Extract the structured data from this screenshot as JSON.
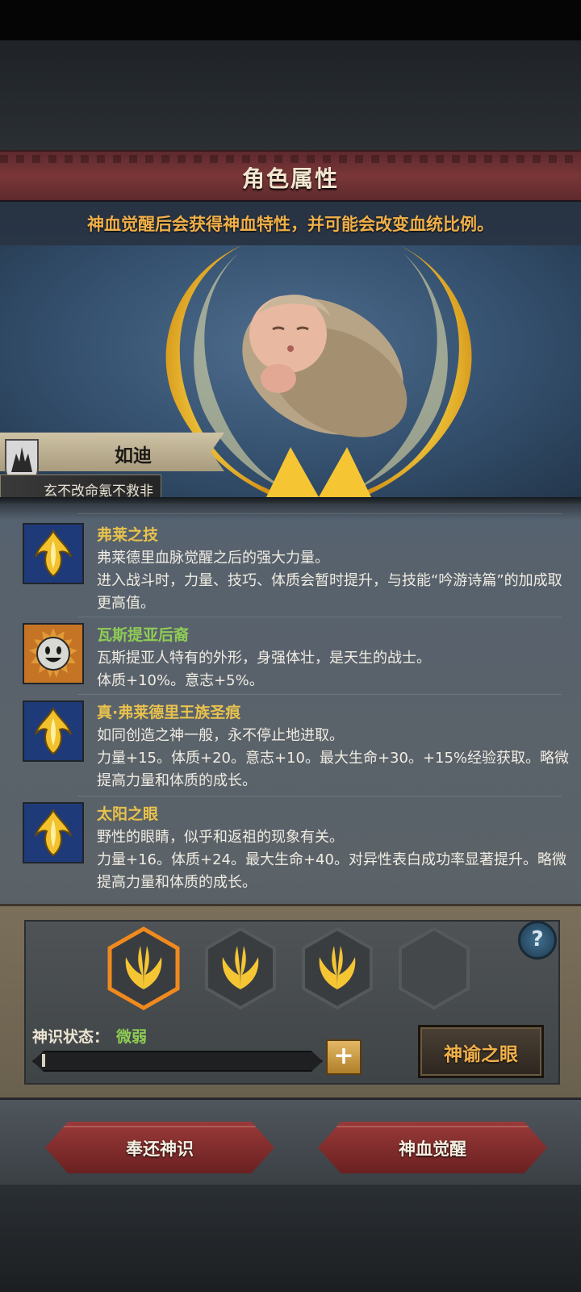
{
  "header": {
    "title": "角色属性"
  },
  "notice": "神血觉醒后会获得神血特性，并可能会改变血统比例。",
  "character": {
    "name": "如迪",
    "subtitle": "玄不改命氪不救非"
  },
  "traits": [
    {
      "name": "弗莱之技",
      "name_color": "gold",
      "icon": "golden-crest-icon",
      "desc": "弗莱德里血脉觉醒之后的强大力量。\n进入战斗时，力量、技巧、体质会暂时提升，与技能“吟游诗篇”的加成取更高值。"
    },
    {
      "name": "瓦斯提亚后裔",
      "name_color": "green",
      "icon": "smiling-face-icon",
      "desc": "瓦斯提亚人特有的外形，身强体壮，是天生的战士。\n体质+10%。意志+5%。"
    },
    {
      "name": "真·弗莱德里王族圣痕",
      "name_color": "gold",
      "icon": "golden-crest-icon",
      "desc": "如同创造之神一般，永不停止地进取。\n力量+15。体质+20。意志+10。最大生命+30。+15%经验获取。略微提高力量和体质的成长。"
    },
    {
      "name": "太阳之眼",
      "name_color": "gold",
      "icon": "golden-crest-icon",
      "desc": "野性的眼睛，似乎和返祖的现象有关。\n力量+16。体质+24。最大生命+40。对异性表白成功率显著提升。略微提高力量和体质的成长。"
    }
  ],
  "slots": {
    "items": [
      {
        "state": "selected",
        "icon": "golden-wings-icon"
      },
      {
        "state": "filled",
        "icon": "golden-wings-icon"
      },
      {
        "state": "filled",
        "icon": "golden-wings-icon"
      },
      {
        "state": "empty",
        "icon": ""
      }
    ],
    "help_label": "?"
  },
  "divine_sense": {
    "label": "神识状态：",
    "value": "微弱",
    "progress": 0.01
  },
  "buttons": {
    "plus": "+",
    "oracle_eye": "神谕之眼",
    "return_sense": "奉还神识",
    "blood_awaken": "神血觉醒"
  },
  "colors": {
    "gold_text": "#e8c24c",
    "green_text": "#8fcc55",
    "orange_text": "#f0b04a",
    "title_red": "#7a3638"
  }
}
